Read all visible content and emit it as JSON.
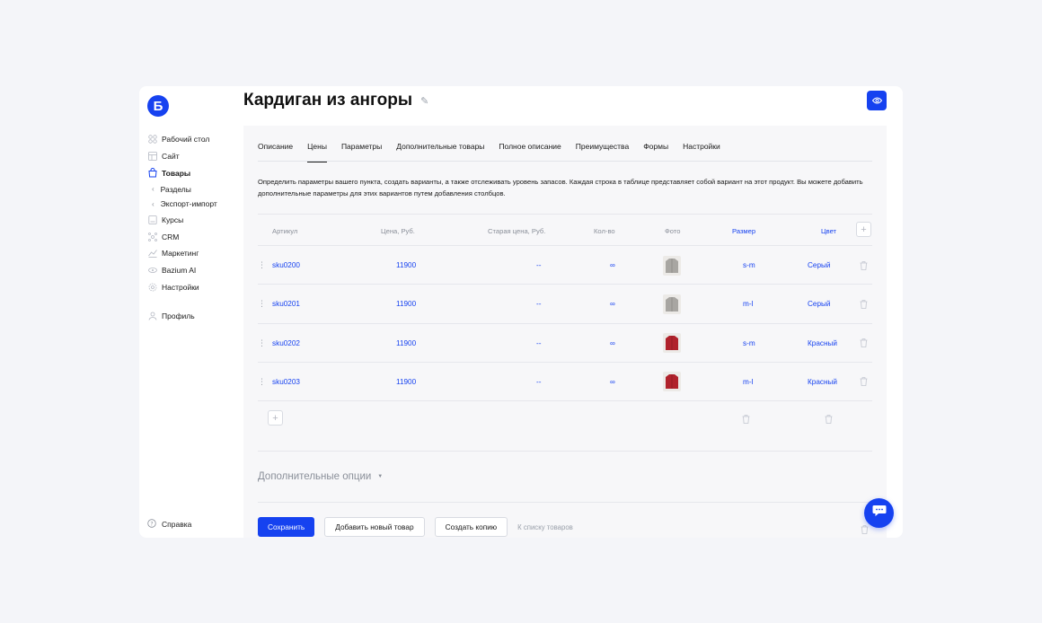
{
  "sidebar": {
    "logo": "Б",
    "items": [
      {
        "label": "Рабочий стол",
        "icon": "dashboard-icon"
      },
      {
        "label": "Сайт",
        "icon": "site-icon"
      },
      {
        "label": "Товары",
        "icon": "bag-icon",
        "active": true
      },
      {
        "label": "Разделы",
        "sub": true
      },
      {
        "label": "Экспорт-импорт",
        "sub": true
      },
      {
        "label": "Курсы",
        "icon": "book-icon"
      },
      {
        "label": "CRM",
        "icon": "crm-icon"
      },
      {
        "label": "Маркетинг",
        "icon": "chart-icon"
      },
      {
        "label": "Bazium AI",
        "icon": "ai-icon"
      },
      {
        "label": "Настройки",
        "icon": "gear-icon"
      },
      {
        "label": "Профиль",
        "icon": "user-icon"
      }
    ],
    "help_label": "Справка"
  },
  "header": {
    "title": "Кардиган из ангоры"
  },
  "tabs": [
    {
      "label": "Описание"
    },
    {
      "label": "Цены",
      "active": true
    },
    {
      "label": "Параметры"
    },
    {
      "label": "Дополнительные товары"
    },
    {
      "label": "Полное описание"
    },
    {
      "label": "Преимущества"
    },
    {
      "label": "Формы"
    },
    {
      "label": "Настройки"
    }
  ],
  "description": "Определить параметры вашего пункта, создать варианты, а также отслеживать уровень запасов. Каждая строка в таблице представляет собой вариант на этот продукт. Вы можете добавить дополнительные параметры для этих вариантов путем добавления столбцов.",
  "table": {
    "columns": {
      "sku": "Артикул",
      "price": "Цена, Руб.",
      "old_price": "Старая цена, Руб.",
      "qty": "Кол-во",
      "photo": "Фото",
      "size": "Размер",
      "color": "Цвет"
    },
    "rows": [
      {
        "sku": "sku0200",
        "price": "11900",
        "old_price": "--",
        "qty": "∞",
        "photo_color": "#a8a6a2",
        "size": "s-m",
        "color": "Серый"
      },
      {
        "sku": "sku0201",
        "price": "11900",
        "old_price": "--",
        "qty": "∞",
        "photo_color": "#a8a6a2",
        "size": "m-l",
        "color": "Серый"
      },
      {
        "sku": "sku0202",
        "price": "11900",
        "old_price": "--",
        "qty": "∞",
        "photo_color": "#b0222c",
        "size": "s-m",
        "color": "Красный"
      },
      {
        "sku": "sku0203",
        "price": "11900",
        "old_price": "--",
        "qty": "∞",
        "photo_color": "#b0222c",
        "size": "m-l",
        "color": "Красный"
      }
    ]
  },
  "extra_options_label": "Дополнительные опции",
  "footer": {
    "save": "Сохранить",
    "add_new": "Добавить новый товар",
    "copy": "Создать копию",
    "to_list": "К списку товаров"
  },
  "colors": {
    "accent": "#1642f0",
    "panel_bg": "#f7f7f9",
    "page_bg": "#f4f5f9"
  }
}
